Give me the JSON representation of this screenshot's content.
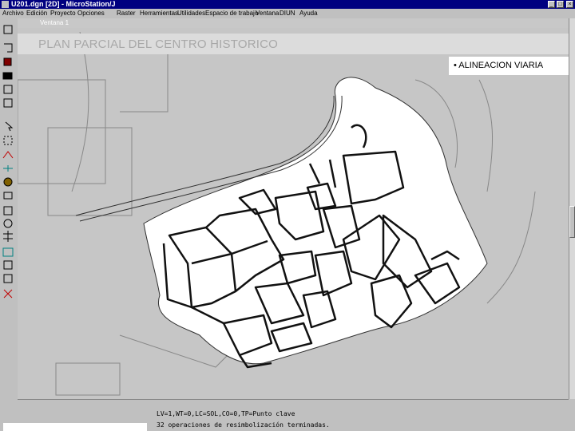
{
  "window": {
    "title": "U201.dgn [2D] - MicroStation/J",
    "controls": {
      "minimize": "_",
      "maximize": "□",
      "close": "×"
    }
  },
  "menu": [
    "Archivo",
    "Edición",
    "Proyecto",
    "Opciones",
    "Raster",
    "Herramientas",
    "Utilidades",
    "Espacio de trabajo",
    "Ventana",
    "DIUN",
    "Ayuda"
  ],
  "view": {
    "title": "Ventana 1"
  },
  "banner": {
    "text": "PLAN PARCIAL DEL CENTRO HISTORICO"
  },
  "legend": {
    "text": "• ALINEACION VIARIA"
  },
  "status": {
    "line1": "LV=1,WT=0,LC=SOL,CO=0,TP=Punto clave",
    "line2": "32 operaciones de resimbolización terminadas."
  },
  "colors": {
    "titlebar": "#000080",
    "chrome": "#c0c0c0",
    "drawing_bg": "#c6c6c6",
    "block": "#ffffff"
  },
  "icons": [
    "app-icon",
    "element-selection-icon",
    "fence-icon",
    "line-icon",
    "arc-icon",
    "text-icon",
    "cell-icon",
    "measure-icon",
    "zoom-icon",
    "copy-icon",
    "array-icon",
    "delete-icon"
  ]
}
